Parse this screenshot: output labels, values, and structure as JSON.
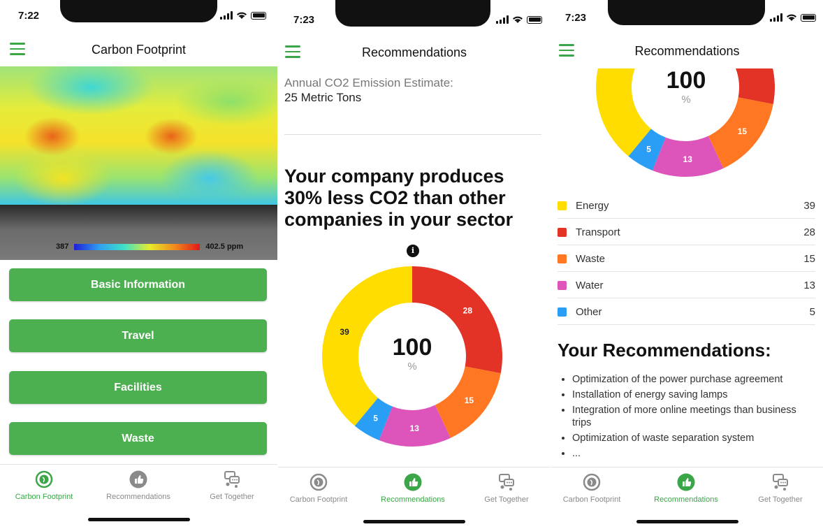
{
  "screen1": {
    "status_time": "7:22",
    "title": "Carbon Footprint",
    "map_legend_min": "387",
    "map_legend_max": "402.5 ppm",
    "buttons": [
      "Basic Information",
      "Travel",
      "Facilities",
      "Waste"
    ]
  },
  "screen2": {
    "status_time": "7:23",
    "title": "Recommendations",
    "estimate_label": "Annual CO2 Emission Estimate:",
    "estimate_value": "25 Metric Tons",
    "headline": "Your company produces 30% less CO2 than other companies in your sector",
    "info_icon_glyph": "i",
    "donut_total": "100",
    "donut_unit": "%"
  },
  "screen3": {
    "status_time": "7:23",
    "title": "Recommendations",
    "donut_total": "100",
    "donut_unit": "%",
    "recommendations_title": "Your Recommendations:",
    "recommendations": [
      "Optimization of the power purchase agreement",
      "Installation of energy saving lamps",
      "Integration of more online meetings than business trips",
      "Optimization of waste separation system",
      "..."
    ]
  },
  "tabs": [
    {
      "label": "Carbon Footprint",
      "icon": "footprint-icon"
    },
    {
      "label": "Recommendations",
      "icon": "thumbs-up-icon"
    },
    {
      "label": "Get Together",
      "icon": "chat-people-icon"
    }
  ],
  "colors": {
    "primary_green": "#4caf50",
    "energy": "#ffdd00",
    "transport": "#e33326",
    "waste": "#ff7722",
    "water": "#dd55bb",
    "other": "#2a9df4"
  },
  "chart_data": {
    "type": "pie",
    "donut": true,
    "categories": [
      "Energy",
      "Transport",
      "Waste",
      "Water",
      "Other"
    ],
    "values": [
      39,
      28,
      15,
      13,
      5
    ],
    "center_label": "100 %"
  }
}
